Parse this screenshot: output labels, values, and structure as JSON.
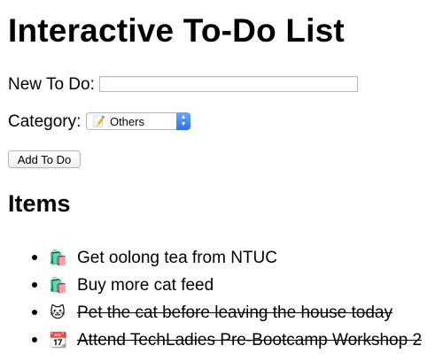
{
  "page": {
    "title": "Interactive To-Do List"
  },
  "form": {
    "new_label": "New To Do:",
    "new_value": "",
    "new_placeholder": "",
    "category_label": "Category:",
    "category_value": "Others",
    "category_icon": "memo-icon",
    "add_button": "Add To Do"
  },
  "items_heading": "Items",
  "items": [
    {
      "text": "Get oolong tea from NTUC",
      "icon": "shopping-bags-icon",
      "glyph": "🛍️",
      "done": false
    },
    {
      "text": "Buy more cat feed",
      "icon": "shopping-bags-icon",
      "glyph": "🛍️",
      "done": false
    },
    {
      "text": "Pet the cat before leaving the house today",
      "icon": "cat-face-icon",
      "glyph": "🐱",
      "done": true
    },
    {
      "text": "Attend TechLadies Pre-Bootcamp Workshop 2",
      "icon": "calendar-icon",
      "glyph": "📆",
      "done": true
    }
  ]
}
